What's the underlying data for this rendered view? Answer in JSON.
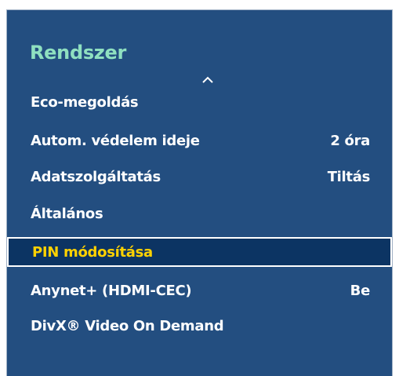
{
  "menu": {
    "title": "Rendszer",
    "items": [
      {
        "label": "Eco-megoldás",
        "value": ""
      },
      {
        "label": "Autom. védelem ideje",
        "value": "2 óra"
      },
      {
        "label": "Adatszolgáltatás",
        "value": "Tiltás"
      },
      {
        "label": "Általános",
        "value": ""
      },
      {
        "label": "PIN módosítása",
        "value": ""
      },
      {
        "label": "Anynet+ (HDMI-CEC)",
        "value": "Be"
      },
      {
        "label": "DivX® Video On Demand",
        "value": ""
      }
    ],
    "selected_index": 4
  },
  "icons": {
    "scroll_up": "chevron-up-icon"
  },
  "colors": {
    "panel_bg": "#234e80",
    "title": "#8fe0c0",
    "item_text": "#ffffff",
    "selected_bg": "#0c3463",
    "selected_text": "#ffd200",
    "selected_border": "#ffffff"
  }
}
